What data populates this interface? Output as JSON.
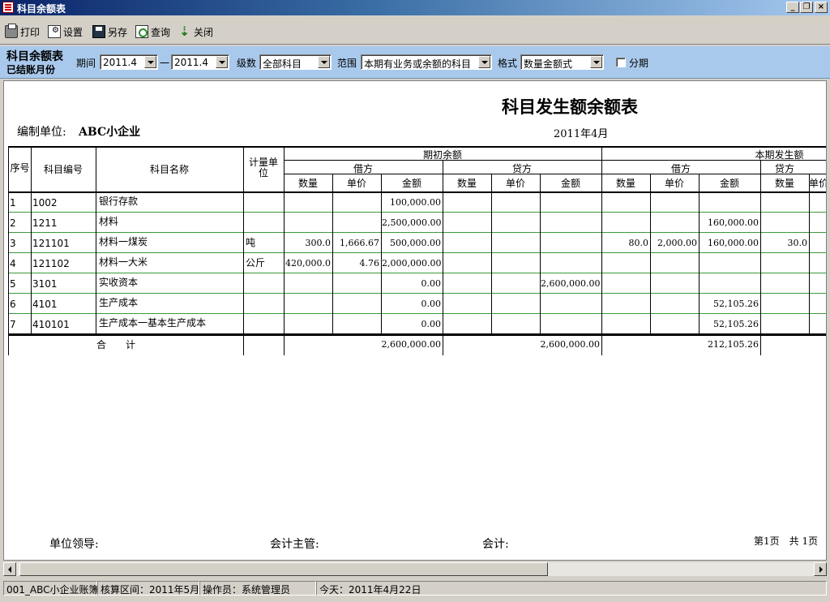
{
  "window": {
    "title": "科目余额表"
  },
  "toolbar": [
    {
      "label": "打印",
      "icon": "printer-icon"
    },
    {
      "label": "设置",
      "icon": "settings-icon"
    },
    {
      "label": "另存",
      "icon": "save-icon"
    },
    {
      "label": "查询",
      "icon": "query-icon"
    },
    {
      "label": "关闭",
      "icon": "close-door-icon"
    }
  ],
  "filter": {
    "title": "科目余额表",
    "subtitle": "已结账月份",
    "period_label": "期间",
    "period_from": "2011.4",
    "period_sep": "一",
    "period_to": "2011.4",
    "level_label": "级数",
    "level_value": "全部科目",
    "scope_label": "范围",
    "scope_value": "本期有业务或余额的科目",
    "format_label": "格式",
    "format_value": "数量金额式",
    "split_label": "分期"
  },
  "report": {
    "title": "科目发生额余额表",
    "date": "2011年4月",
    "unit_label": "编制单位:",
    "unit": "ABC小企业",
    "headers": {
      "seq": "序号",
      "code": "科目编号",
      "name": "科目名称",
      "unit_of_measure": "计量单位",
      "opening": "期初余额",
      "current": "本期发生额",
      "debit": "借方",
      "credit": "贷方",
      "qty": "数量",
      "price": "单价",
      "amount": "金额"
    },
    "rows": [
      {
        "seq": "1",
        "code": "1002",
        "name": "银行存款",
        "uom": "",
        "o_dq": "",
        "o_dp": "",
        "o_da": "100,000.00",
        "o_cq": "",
        "o_cp": "",
        "o_ca": "",
        "c_dq": "",
        "c_dp": "",
        "c_da": "",
        "c_cq": ""
      },
      {
        "seq": "2",
        "code": "1211",
        "name": "材料",
        "uom": "",
        "o_dq": "",
        "o_dp": "",
        "o_da": "2,500,000.00",
        "o_cq": "",
        "o_cp": "",
        "o_ca": "",
        "c_dq": "",
        "c_dp": "",
        "c_da": "160,000.00",
        "c_cq": ""
      },
      {
        "seq": "3",
        "code": "121101",
        "name": "材料一煤炭",
        "uom": "吨",
        "o_dq": "300.0",
        "o_dp": "1,666.67",
        "o_da": "500,000.00",
        "o_cq": "",
        "o_cp": "",
        "o_ca": "",
        "c_dq": "80.0",
        "c_dp": "2,000.00",
        "c_da": "160,000.00",
        "c_cq": "30.0"
      },
      {
        "seq": "4",
        "code": "121102",
        "name": "材料一大米",
        "uom": "公斤",
        "o_dq": "420,000.0",
        "o_dp": "4.76",
        "o_da": "2,000,000.00",
        "o_cq": "",
        "o_cp": "",
        "o_ca": "",
        "c_dq": "",
        "c_dp": "",
        "c_da": "",
        "c_cq": ""
      },
      {
        "seq": "5",
        "code": "3101",
        "name": "实收资本",
        "uom": "",
        "o_dq": "",
        "o_dp": "",
        "o_da": "0.00",
        "o_cq": "",
        "o_cp": "",
        "o_ca": "2,600,000.00",
        "c_dq": "",
        "c_dp": "",
        "c_da": "",
        "c_cq": ""
      },
      {
        "seq": "6",
        "code": "4101",
        "name": "生产成本",
        "uom": "",
        "o_dq": "",
        "o_dp": "",
        "o_da": "0.00",
        "o_cq": "",
        "o_cp": "",
        "o_ca": "",
        "c_dq": "",
        "c_dp": "",
        "c_da": "52,105.26",
        "c_cq": ""
      },
      {
        "seq": "7",
        "code": "410101",
        "name": "生产成本一基本生产成本",
        "uom": "",
        "o_dq": "",
        "o_dp": "",
        "o_da": "0.00",
        "o_cq": "",
        "o_cp": "",
        "o_ca": "",
        "c_dq": "",
        "c_dp": "",
        "c_da": "52,105.26",
        "c_cq": ""
      }
    ],
    "total": {
      "label": "合　　计",
      "o_da": "2,600,000.00",
      "o_ca": "2,600,000.00",
      "c_da": "212,105.26"
    },
    "signatures": {
      "leader": "单位领导:",
      "chief": "会计主管:",
      "accountant": "会计:"
    },
    "page": "第1页　共 1页"
  },
  "status": {
    "book": "001_ABC小企业账簿",
    "period": "核算区间：2011年5月",
    "operator": "操作员：系统管理员",
    "today": "今天：2011年4月22日"
  },
  "colors": {
    "title_bar": "#0a246a",
    "filter_bar": "#a9c9ec",
    "row_separator": "#3a9a3a"
  }
}
